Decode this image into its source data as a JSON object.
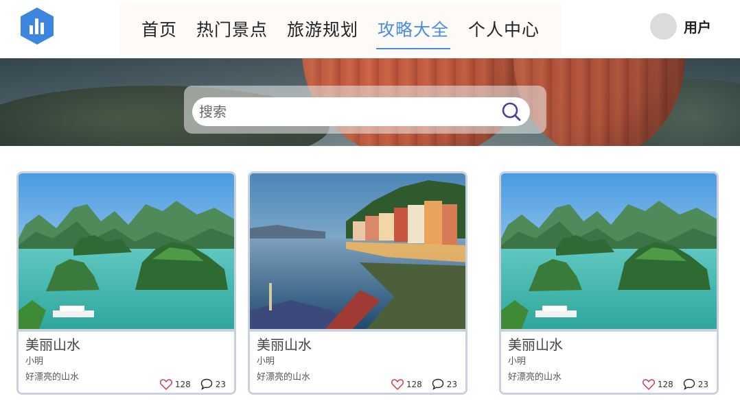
{
  "header": {
    "logo_icon": "bar-chart-icon",
    "nav": [
      {
        "label": "首页",
        "active": false
      },
      {
        "label": "热门景点",
        "active": false
      },
      {
        "label": "旅游规划",
        "active": false
      },
      {
        "label": "攻略大全",
        "active": true
      },
      {
        "label": "个人中心",
        "active": false
      }
    ],
    "user": {
      "name": "用户"
    }
  },
  "hero": {
    "search": {
      "placeholder": "搜索",
      "value": ""
    }
  },
  "cards": [
    {
      "title": "美丽山水",
      "author": "小明",
      "desc": "好漂亮的山水",
      "likes": "128",
      "comments": "23",
      "image": "karst-bay-image"
    },
    {
      "title": "美丽山水",
      "author": "小明",
      "desc": "好漂亮的山水",
      "likes": "128",
      "comments": "23",
      "image": "lakeside-village-image"
    },
    {
      "title": "美丽山水",
      "author": "小明",
      "desc": "好漂亮的山水",
      "likes": "128",
      "comments": "23",
      "image": "karst-bay-image"
    }
  ],
  "colors": {
    "accent": "#4a8de0",
    "logo": "#3d86e0",
    "card_border": "#c8d1dd",
    "search_icon": "#4a3fa0"
  }
}
